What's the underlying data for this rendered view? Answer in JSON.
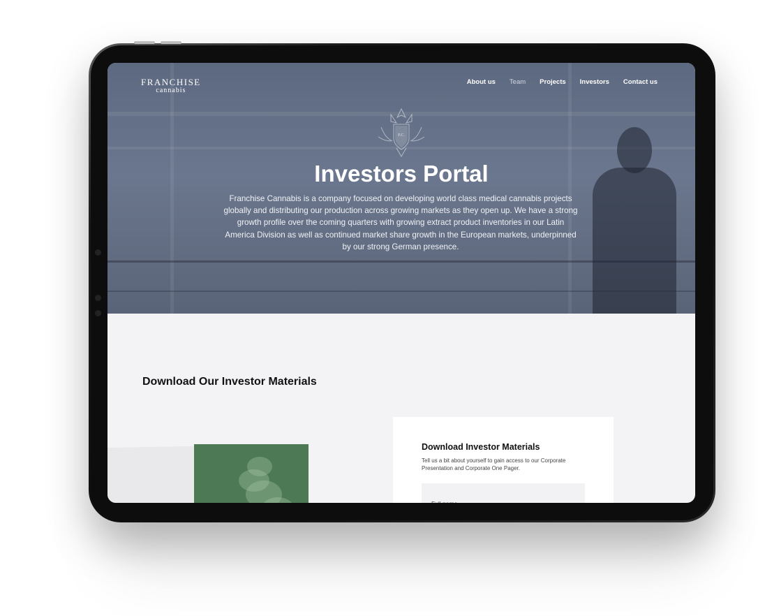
{
  "brand": {
    "name_top": "FRANCHISE",
    "name_bottom": "cannabis"
  },
  "nav": {
    "items": [
      {
        "label": "About us"
      },
      {
        "label": "Team"
      },
      {
        "label": "Projects"
      },
      {
        "label": "Investors"
      },
      {
        "label": "Contact us"
      }
    ]
  },
  "hero": {
    "crest_text": "F.C.",
    "title": "Investors Portal",
    "text": "Franchise Cannabis is a company focused on developing world class medical cannabis projects globally and distributing our production across growing markets as they open up. We have a strong growth profile over the coming quarters with growing extract product inventories in our Latin America Division as well as continued market share growth in the European markets, underpinned by our strong German presence."
  },
  "materials": {
    "section_title": "Download Our Investor Materials",
    "form": {
      "title": "Download Investor Materials",
      "description": "Tell us a bit about yourself to gain access to our Corporate Presentation and Corporate One Pager.",
      "full_name_placeholder": "Full name"
    }
  },
  "colors": {
    "hero_overlay": "#5d6980",
    "page_background": "#f3f3f6",
    "book_green": "#4d7a55"
  }
}
